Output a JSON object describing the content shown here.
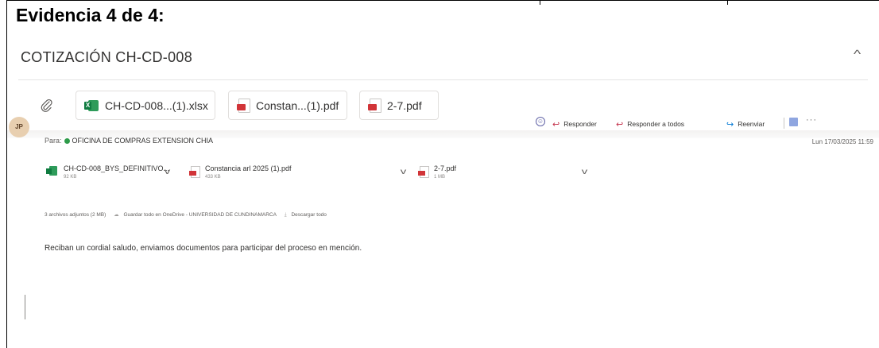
{
  "document": {
    "heading": "Evidencia 4 de 4:"
  },
  "email": {
    "subject": "COTIZACIÓN CH-CD-008",
    "top_attachments": [
      {
        "label": "CH-CD-008...(1).xlsx",
        "icon": "excel-file-icon"
      },
      {
        "label": "Constan...(1).pdf",
        "icon": "pdf-file-icon"
      },
      {
        "label": "2-7.pdf",
        "icon": "pdf-file-icon"
      }
    ],
    "sender_initials": "JP",
    "to_label": "Para:",
    "to_name": "OFICINA DE COMPRAS EXTENSION CHIA",
    "actions": {
      "reply": "Responder",
      "reply_all": "Responder a todos",
      "forward": "Reenviar"
    },
    "date": "Lun 17/03/2025 11:59",
    "attachments": [
      {
        "name": "CH-CD-008_BYS_DEFINITIVO...",
        "size": "92 KB",
        "icon": "excel-file-icon"
      },
      {
        "name": "Constancia arl 2025 (1).pdf",
        "size": "433 KB",
        "icon": "pdf-file-icon"
      },
      {
        "name": "2-7.pdf",
        "size": "1 MB",
        "icon": "pdf-file-icon"
      }
    ],
    "attachments_summary": {
      "count": "3 archivos adjuntos (2 MB)",
      "save_all": "Guardar todo en OneDrive - UNIVERSIDAD DE CUNDINAMARCA",
      "download_all": "Descargar todo"
    },
    "body": "Reciban un cordial saludo, enviamos documentos para participar del proceso en mención."
  },
  "colors": {
    "reply_accent": "#c4314b",
    "forward_accent": "#0078d4",
    "excel_green": "#107c41",
    "pdf_red": "#d13438",
    "presence_green": "#2e9b4a"
  }
}
